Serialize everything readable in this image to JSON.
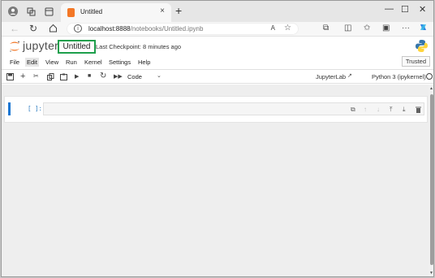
{
  "browser": {
    "tab_title": "Untitled",
    "tab_close": "×",
    "new_tab": "+",
    "window_controls": [
      "—",
      "☐",
      "✕"
    ],
    "url_host": "localhost:8888",
    "url_path": "/notebooks/Untitled.ipynb",
    "read_aloud_label": "A",
    "colors": {
      "favicon": "#f37726",
      "tab_active": "#f7f7f7",
      "tabbar": "#e6e6e6"
    }
  },
  "jupyter": {
    "logo_text": "jupyter",
    "notebook_name": "Untitled",
    "checkpoint": "Last Checkpoint: 8 minutes ago",
    "name_highlight_color": "#1e9f4c"
  },
  "menu": {
    "items": [
      "File",
      "Edit",
      "View",
      "Run",
      "Kernel",
      "Settings",
      "Help"
    ],
    "active": "Edit",
    "trusted": "Trusted"
  },
  "toolbar": {
    "cell_type": "Code",
    "jupyterlab": "JupyterLab",
    "kernel": "Python 3 (ipykernel)",
    "icons": [
      "save-icon",
      "add-cell-icon",
      "cut-icon",
      "copy-icon",
      "paste-icon",
      "run-icon",
      "stop-icon",
      "restart-icon",
      "run-all-icon"
    ]
  },
  "cell": {
    "prompt": "[ ]:",
    "content": "",
    "accent": "#1976d2",
    "icons": [
      "duplicate-icon",
      "move-up-icon",
      "move-down-icon",
      "insert-above-icon",
      "insert-below-icon",
      "delete-icon"
    ]
  }
}
